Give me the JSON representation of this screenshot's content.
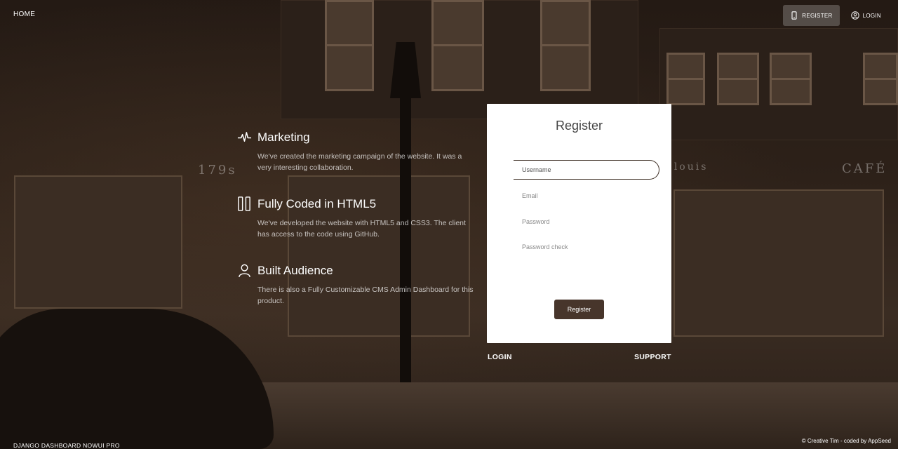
{
  "navbar": {
    "home_label": "HOME",
    "register_label": "REGISTER",
    "login_label": "LOGIN"
  },
  "features": [
    {
      "icon": "pulse-icon",
      "title": "Marketing",
      "description": "We've created the marketing campaign of the website. It was a very interesting collaboration."
    },
    {
      "icon": "html5-columns-icon",
      "title": "Fully Coded in HTML5",
      "description": "We've developed the website with HTML5 and CSS3. The client has access to the code using GitHub."
    },
    {
      "icon": "user-icon",
      "title": "Built Audience",
      "description": "There is also a Fully Customizable CMS Admin Dashboard for this product."
    }
  ],
  "register_card": {
    "title": "Register",
    "username_placeholder": "Username",
    "email_placeholder": "Email",
    "password_placeholder": "Password",
    "password_repeat_placeholder": "Password check",
    "submit_label": "Register"
  },
  "links": {
    "login": "LOGIN",
    "support": "SUPPORT"
  },
  "footer": {
    "brand": "DJANGO DASHBOARD NOWUI PRO",
    "copyright": "© Creative Tim - coded by AppSeed"
  },
  "colors": {
    "accent": "#47352b",
    "background": "#2b2019"
  }
}
